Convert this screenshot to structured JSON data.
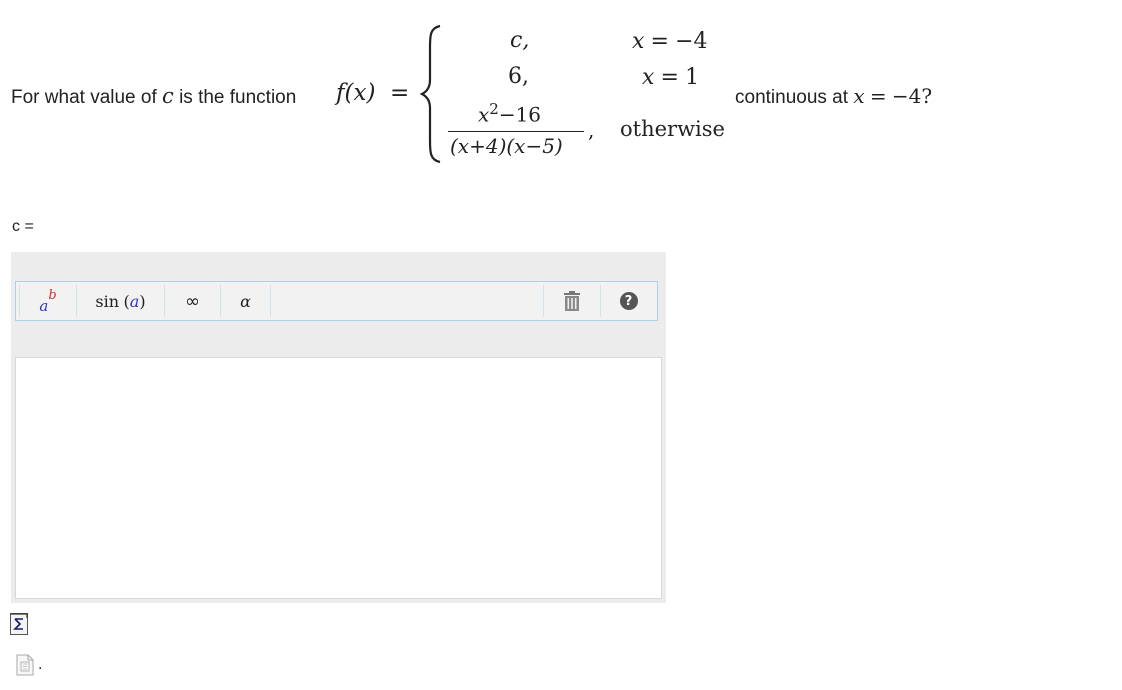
{
  "question": {
    "prefix": "For what value of",
    "var_c": "c",
    "middle": "is the function",
    "func": "f(x)",
    "equals": "=",
    "cases": [
      {
        "value": "c,",
        "condition_var": "x",
        "condition_rel": "=",
        "condition_val": "−4"
      },
      {
        "value": "6,",
        "condition_var": "x",
        "condition_rel": "=",
        "condition_val": "1"
      },
      {
        "numerator": "x",
        "numerator_exp": "2",
        "numerator_rest": "−16",
        "denominator": "(x+4)(x−5)",
        "comma": ",",
        "condition": "otherwise"
      }
    ],
    "suffix_text": "continuous at",
    "suffix_var": "x",
    "suffix_rel": "=",
    "suffix_val": "−4?"
  },
  "answer": {
    "label": "c =",
    "input_value": ""
  },
  "toolbar": {
    "power": {
      "base": "a",
      "exp": "b",
      "icon": "power-icon"
    },
    "sin": {
      "fn": "sin",
      "open": "(",
      "arg": "a",
      "close": ")"
    },
    "infinity": "∞",
    "alpha": "α",
    "trash_icon": "trash-icon",
    "help": "?"
  },
  "footer": {
    "sigma_icon": "equation-editor-icon",
    "doc_icon": "document-icon",
    "dot": "."
  }
}
